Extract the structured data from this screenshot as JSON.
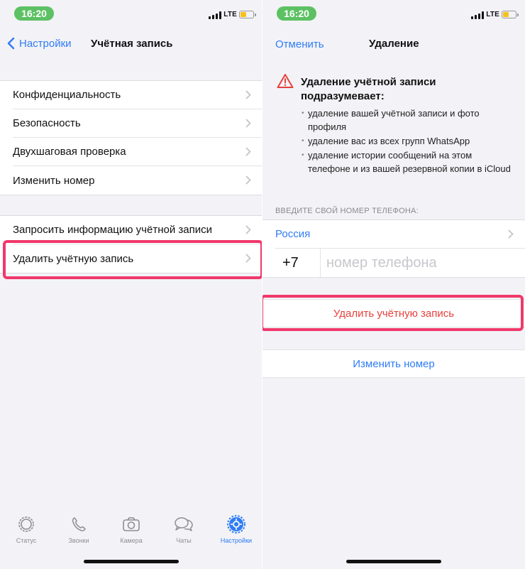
{
  "status_bar": {
    "time": "16:20",
    "network": "LTE"
  },
  "left": {
    "nav": {
      "back_label": "Настройки",
      "title": "Учётная запись"
    },
    "group1": [
      "Конфиденциальность",
      "Безопасность",
      "Двухшаговая проверка",
      "Изменить номер"
    ],
    "group2": [
      "Запросить информацию учётной записи",
      "Удалить учётную запись"
    ],
    "tabs": [
      {
        "label": "Статус",
        "icon": "status-icon"
      },
      {
        "label": "Звонки",
        "icon": "phone-icon"
      },
      {
        "label": "Камера",
        "icon": "camera-icon"
      },
      {
        "label": "Чаты",
        "icon": "chats-icon"
      },
      {
        "label": "Настройки",
        "icon": "settings-icon",
        "active": true
      }
    ]
  },
  "right": {
    "nav": {
      "cancel_label": "Отменить",
      "title": "Удаление"
    },
    "warning": {
      "title": "Удаление учётной записи подразумевает:",
      "bullets": [
        "удаление вашей учётной записи и фото профиля",
        "удаление вас из всех групп WhatsApp",
        "удаление истории сообщений на этом телефоне и из вашей резервной копии в iCloud"
      ]
    },
    "phone_section_label": "ВВЕДИТЕ СВОЙ НОМЕР ТЕЛЕФОНА:",
    "country": "Россия",
    "country_code": "+7",
    "phone_placeholder": "номер телефона",
    "delete_button": "Удалить учётную запись",
    "change_number_button": "Изменить номер"
  },
  "colors": {
    "accent": "#2f7cf6",
    "danger": "#e5413b",
    "highlight": "#f0386b",
    "status_green": "#5cc163"
  }
}
